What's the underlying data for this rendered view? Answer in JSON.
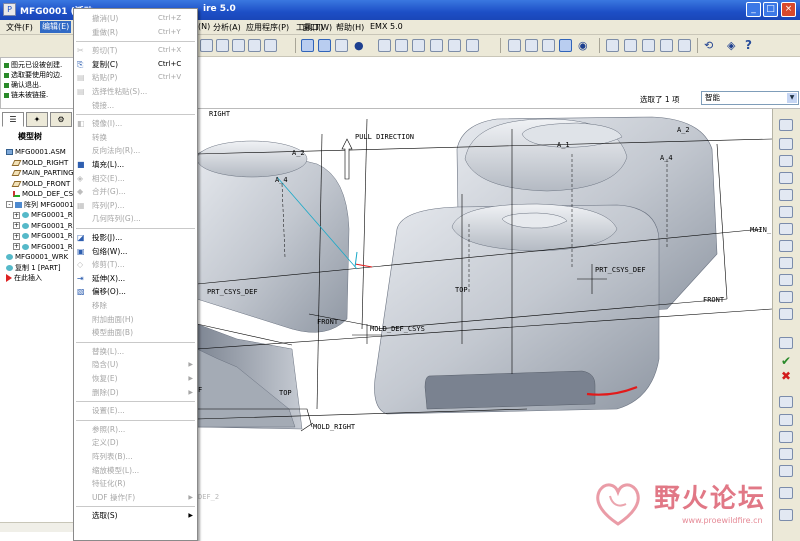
{
  "window": {
    "title_left": "MFG0001 (活动",
    "title_right": "ire 5.0",
    "minimize": "_",
    "maximize": "□",
    "close": "×"
  },
  "menubar": {
    "items": [
      "文件(F)",
      "编辑(E)",
      "(N)",
      "分析(A)",
      "应用程序(P)",
      "工具(T)",
      "窗口(W)",
      "帮助(H)",
      "EMX 5.0"
    ]
  },
  "toolbar": {
    "help_glyph": "?"
  },
  "messages": [
    "图元已设被创建.",
    "选取要使用的边.",
    "确认退出.",
    "链未被链接."
  ],
  "status": {
    "selection": "选取了 1 项",
    "filter": "智能"
  },
  "model_tree": {
    "tabs": [
      "☰",
      "✦",
      "⚙"
    ],
    "title": "模型树",
    "rows": [
      {
        "label": "MFG0001.ASM",
        "icon": "assembly-icon",
        "indent": 0,
        "expand": ""
      },
      {
        "label": "MOLD_RIGHT",
        "icon": "datum-plane-icon",
        "indent": 1,
        "expand": ""
      },
      {
        "label": "MAIN_PARTING",
        "icon": "datum-plane-icon",
        "indent": 1,
        "expand": ""
      },
      {
        "label": "MOLD_FRONT",
        "icon": "datum-plane-icon",
        "indent": 1,
        "expand": ""
      },
      {
        "label": "MOLD_DEF_CSYS",
        "icon": "csys-icon",
        "indent": 1,
        "expand": ""
      },
      {
        "label": "阵列 MFG0001",
        "icon": "pattern-icon",
        "indent": 0,
        "expand": "-"
      },
      {
        "label": "MFG0001_R",
        "icon": "part-icon",
        "indent": 1,
        "expand": "+"
      },
      {
        "label": "MFG0001_R",
        "icon": "part-icon",
        "indent": 1,
        "expand": "+"
      },
      {
        "label": "MFG0001_R",
        "icon": "part-icon",
        "indent": 1,
        "expand": "+"
      },
      {
        "label": "MFG0001_R",
        "icon": "part-icon",
        "indent": 1,
        "expand": "+"
      },
      {
        "label": "MFG0001_WRK",
        "icon": "part-icon",
        "indent": 0,
        "expand": ""
      },
      {
        "label": "复制 1 [PART]",
        "icon": "surface-icon",
        "indent": 0,
        "expand": ""
      },
      {
        "label": "在此插入",
        "icon": "insert-here-icon",
        "indent": 0,
        "expand": ""
      }
    ]
  },
  "edit_menu": {
    "items": [
      {
        "label": "撤消(U)",
        "shortcut": "Ctrl+Z",
        "enabled": false,
        "icon": "",
        "submenu": false
      },
      {
        "label": "重做(R)",
        "shortcut": "Ctrl+Y",
        "enabled": false,
        "icon": "",
        "submenu": false
      },
      {
        "sep": true
      },
      {
        "label": "剪切(T)",
        "shortcut": "Ctrl+X",
        "enabled": false,
        "icon": "✂",
        "submenu": false
      },
      {
        "label": "复制(C)",
        "shortcut": "Ctrl+C",
        "enabled": true,
        "icon": "⎘",
        "submenu": false
      },
      {
        "label": "粘贴(P)",
        "shortcut": "Ctrl+V",
        "enabled": false,
        "icon": "▤",
        "submenu": false
      },
      {
        "label": "选择性粘贴(S)...",
        "shortcut": "",
        "enabled": false,
        "icon": "▤",
        "submenu": false
      },
      {
        "label": "镜接...",
        "shortcut": "",
        "enabled": false,
        "icon": "",
        "submenu": false
      },
      {
        "sep": true
      },
      {
        "label": "镜像(I)...",
        "shortcut": "",
        "enabled": false,
        "icon": "◧",
        "submenu": false
      },
      {
        "label": "转换",
        "shortcut": "",
        "enabled": false,
        "icon": "",
        "submenu": false
      },
      {
        "label": "反向法向(R)...",
        "shortcut": "",
        "enabled": false,
        "icon": "",
        "submenu": false
      },
      {
        "label": "填充(L)...",
        "shortcut": "",
        "enabled": true,
        "icon": "■",
        "submenu": false
      },
      {
        "label": "相交(E)...",
        "shortcut": "",
        "enabled": false,
        "icon": "◈",
        "submenu": false
      },
      {
        "label": "合并(G)...",
        "shortcut": "",
        "enabled": false,
        "icon": "◆",
        "submenu": false
      },
      {
        "label": "阵列(P)...",
        "shortcut": "",
        "enabled": false,
        "icon": "▦",
        "submenu": false
      },
      {
        "label": "几何阵列(G)...",
        "shortcut": "",
        "enabled": false,
        "icon": "",
        "submenu": false
      },
      {
        "sep": true
      },
      {
        "label": "投影(J)...",
        "shortcut": "",
        "enabled": true,
        "icon": "◪",
        "submenu": false
      },
      {
        "label": "包络(W)...",
        "shortcut": "",
        "enabled": true,
        "icon": "▣",
        "submenu": false
      },
      {
        "label": "修剪(T)...",
        "shortcut": "",
        "enabled": false,
        "icon": "◇",
        "submenu": false
      },
      {
        "label": "延伸(X)...",
        "shortcut": "",
        "enabled": true,
        "icon": "⇥",
        "submenu": false
      },
      {
        "label": "偏移(O)...",
        "shortcut": "",
        "enabled": true,
        "icon": "▧",
        "submenu": false
      },
      {
        "label": "移除",
        "shortcut": "",
        "enabled": false,
        "icon": "",
        "submenu": false
      },
      {
        "label": "附加曲面(H)",
        "shortcut": "",
        "enabled": false,
        "icon": "",
        "submenu": false
      },
      {
        "label": "模型曲面(B)",
        "shortcut": "",
        "enabled": false,
        "icon": "",
        "submenu": false
      },
      {
        "sep": true
      },
      {
        "label": "替换(L)...",
        "shortcut": "",
        "enabled": false,
        "icon": "",
        "submenu": false
      },
      {
        "label": "隐含(U)",
        "shortcut": "",
        "enabled": false,
        "icon": "",
        "submenu": true
      },
      {
        "label": "恢复(E)",
        "shortcut": "",
        "enabled": false,
        "icon": "",
        "submenu": true
      },
      {
        "label": "删除(D)",
        "shortcut": "",
        "enabled": false,
        "icon": "",
        "submenu": true
      },
      {
        "sep": true
      },
      {
        "label": "设置(E)...",
        "shortcut": "",
        "enabled": false,
        "icon": "",
        "submenu": false
      },
      {
        "sep": true
      },
      {
        "label": "参照(R)...",
        "shortcut": "",
        "enabled": false,
        "icon": "",
        "submenu": false
      },
      {
        "label": "定义(D)",
        "shortcut": "",
        "enabled": false,
        "icon": "",
        "submenu": false
      },
      {
        "label": "阵列表(B)...",
        "shortcut": "",
        "enabled": false,
        "icon": "",
        "submenu": false
      },
      {
        "label": "缩放模型(L)...",
        "shortcut": "",
        "enabled": false,
        "icon": "",
        "submenu": false
      },
      {
        "label": "特征化(R)",
        "shortcut": "",
        "enabled": false,
        "icon": "",
        "submenu": false
      },
      {
        "label": "UDF 操作(F)",
        "shortcut": "",
        "enabled": false,
        "icon": "",
        "submenu": true
      },
      {
        "sep": true
      },
      {
        "label": "选取(S)",
        "shortcut": "",
        "enabled": true,
        "icon": "",
        "submenu": true
      }
    ]
  },
  "viewport_labels": {
    "right_top": "RIGHT",
    "pull_direction": "PULL DIRECTION",
    "a1": "A_1",
    "a2_right": "A_2",
    "a4_right": "A_4",
    "a2_left": "A_2",
    "a4_left": "A_4",
    "main": "MAIN_",
    "prt_csys_def_right": "PRT_CSYS_DEF",
    "top_right": "TOP",
    "front_right": "FRONT",
    "prt_csys_def_left": "PRT_CSYS_DEF",
    "front_left": "FRONT",
    "mold_def_csys": "MOLD_DEF_CSYS",
    "top_left": "TOP",
    "mold_right": "MOLD_RIGHT",
    "f_label": "F",
    "def_faint": "DEF_2"
  },
  "watermark": {
    "title": "野火论坛",
    "url": "www.proewildfire.cn"
  },
  "colors": {
    "title_bar": "#1d4fc6",
    "menu_highlight": "#316ac5",
    "model_shade": "#c9ced6",
    "selected_edge": "#e21a1a",
    "watermark": "#d84b5e"
  }
}
